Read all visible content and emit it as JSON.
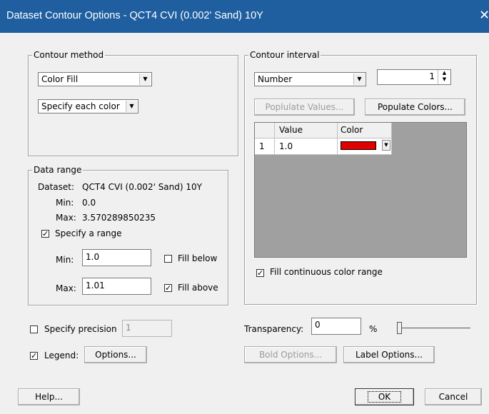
{
  "window": {
    "title": "Dataset Contour Options - QCT4 CVI (0.002' Sand) 10Y",
    "close_glyph": "✕"
  },
  "contour_method": {
    "legend": "Contour method",
    "method_value": "Color Fill",
    "color_mode_value": "Specify each color"
  },
  "data_range": {
    "legend": "Data range",
    "dataset_label": "Dataset:",
    "dataset_value": "QCT4 CVI (0.002' Sand) 10Y",
    "min_label": "Min:",
    "min_value": "0.0",
    "max_label": "Max:",
    "max_value": "3.570289850235",
    "specify_range_label": "Specify a range",
    "specify_range_checked": true,
    "range_min_label": "Min:",
    "range_min_value": "1.0",
    "range_max_label": "Max:",
    "range_max_value": "1.01",
    "fill_below_label": "Fill below",
    "fill_below_checked": false,
    "fill_above_label": "Fill above",
    "fill_above_checked": true
  },
  "contour_interval": {
    "legend": "Contour interval",
    "mode_value": "Number",
    "number_value": "1",
    "populate_values_label": "Poplulate Values...",
    "populate_colors_label": "Populate Colors...",
    "table": {
      "columns": [
        "Value",
        "Color"
      ],
      "rows": [
        {
          "index": "1",
          "value": "1.0",
          "color": "#e00000"
        }
      ]
    },
    "fill_continuous_label": "Fill continuous color range",
    "fill_continuous_checked": true
  },
  "precision": {
    "label": "Specify precision",
    "checked": false,
    "value": "1"
  },
  "legend_row": {
    "label": "Legend:",
    "checked": true,
    "options_label": "Options..."
  },
  "transparency": {
    "label": "Transparency:",
    "value": "0",
    "unit": "%",
    "slider_level_percent": 0
  },
  "bold_options_label": "Bold Options...",
  "label_options_label": "Label Options...",
  "buttons": {
    "help": "Help...",
    "ok": "OK",
    "cancel": "Cancel"
  },
  "check_glyph": "✓",
  "arrow_glyph": "▼"
}
